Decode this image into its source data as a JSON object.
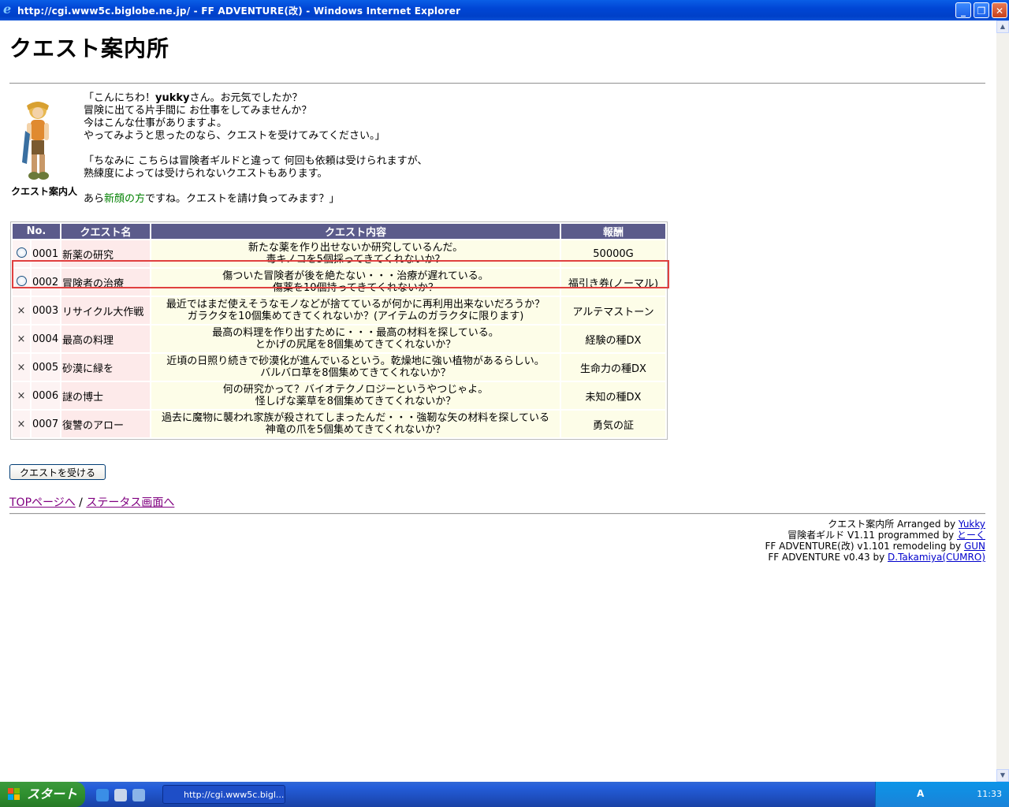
{
  "window": {
    "title": "http://cgi.www5c.biglobe.ne.jp/ - FF ADVENTURE(改) - Windows Internet Explorer",
    "minimize": "_",
    "restore": "❐",
    "close": "✕"
  },
  "page": {
    "heading": "クエスト案内所",
    "guide_caption": "クエスト案内人",
    "intro": {
      "l1a": "「こんにちわ！",
      "l1b": "yukky",
      "l1c": "さん。お元気でしたか？",
      "l2": "冒険に出てる片手間に お仕事をしてみませんか？",
      "l3": "今はこんな仕事がありますよ。",
      "l4": "やってみようと思ったのなら、クエストを受けてみてください。」",
      "l5": "「ちなみに こちらは冒険者ギルドと違って 何回も依頼は受けられますが、",
      "l6": "熟練度によっては受けられないクエストもあります。",
      "l7a": "あら",
      "l7b": "新顔の方",
      "l7c": "ですね。クエストを請け負ってみます？」"
    },
    "table": {
      "headers": [
        "No.",
        "クエスト名",
        "クエスト内容",
        "報酬"
      ],
      "rows": [
        {
          "mark": "radio",
          "no": "0001",
          "name": "新薬の研究",
          "desc1": "新たな薬を作り出せないか研究しているんだ。",
          "desc2": "毒キノコを5個採ってきてくれないか？",
          "reward": "50000G"
        },
        {
          "mark": "radio",
          "no": "0002",
          "name": "冒険者の治療",
          "desc1": "傷ついた冒険者が後を絶たない・・・治療が遅れている。",
          "desc2": "傷薬を10個持ってきてくれないか？",
          "reward": "福引き券(ノーマル)"
        },
        {
          "mark": "×",
          "no": "0003",
          "name": "リサイクル大作戦",
          "desc1": "最近ではまだ使えそうなモノなどが捨てているが何かに再利用出来ないだろうか？",
          "desc2": "ガラクタを10個集めてきてくれないか？(アイテムのガラクタに限ります)",
          "reward": "アルテマストーン"
        },
        {
          "mark": "×",
          "no": "0004",
          "name": "最高の料理",
          "desc1": "最高の料理を作り出すために・・・最高の材料を探している。",
          "desc2": "とかげの尻尾を8個集めてきてくれないか？",
          "reward": "経験の種DX"
        },
        {
          "mark": "×",
          "no": "0005",
          "name": "砂漠に緑を",
          "desc1": "近頃の日照り続きで砂漠化が進んでいるという。乾燥地に強い植物があるらしい。",
          "desc2": "バルバロ草を8個集めてきてくれないか？",
          "reward": "生命力の種DX"
        },
        {
          "mark": "×",
          "no": "0006",
          "name": "謎の博士",
          "desc1": "何の研究かって？バイオテクノロジーというやつじゃよ。",
          "desc2": "怪しげな薬草を8個集めてきてくれないか？",
          "reward": "未知の種DX"
        },
        {
          "mark": "×",
          "no": "0007",
          "name": "復讐のアロー",
          "desc1": "過去に魔物に襲われ家族が殺されてしまったんだ・・・強靭な矢の材料を探している",
          "desc2": "神竜の爪を5個集めてきてくれないか？",
          "reward": "勇気の証"
        }
      ]
    },
    "accept_button": "クエストを受ける",
    "links": {
      "top": "TOPページへ",
      "sep": " / ",
      "status": "ステータス画面へ"
    },
    "credits": [
      {
        "text": "クエスト案内所 Arranged by ",
        "link": "Yukky"
      },
      {
        "text": "冒険者ギルド V1.11 programmed by ",
        "link": "とーく"
      },
      {
        "text": "FF ADVENTURE(改) v1.101 remodeling by ",
        "link": "GUN"
      },
      {
        "text": "FF ADVENTURE v0.43 by ",
        "link": "D.Takamiya(CUMRO)"
      }
    ]
  },
  "taskbar": {
    "start": "スタート",
    "task_label": "http://cgi.www5c.bigl...",
    "clock": "11:33",
    "ime": "A"
  }
}
